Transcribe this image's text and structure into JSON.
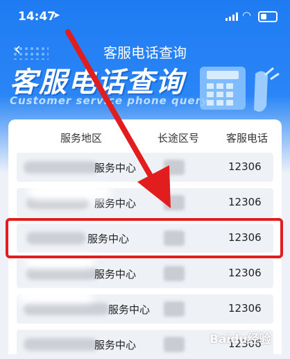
{
  "status_bar": {
    "time": "14:47",
    "location_icon": "location-arrow-icon"
  },
  "nav": {
    "title": "客服电话查询",
    "back_icon": "chevron-left-icon"
  },
  "banner": {
    "title": "客服电话查询",
    "subtitle": "Customer service phone query"
  },
  "table": {
    "headers": [
      "服务地区",
      "长途区号",
      "客服电话"
    ],
    "rows": [
      {
        "service": "服务中心",
        "phone": "12306"
      },
      {
        "service": "服务中心",
        "phone": "12306"
      },
      {
        "service": "服务中心",
        "phone": "12306"
      },
      {
        "service": "服务中心",
        "phone": "12306"
      },
      {
        "service": "服务中心",
        "phone": "12306"
      },
      {
        "service": "服务中心",
        "phone": "12306"
      }
    ]
  },
  "watermark": "Baidu经验",
  "colors": {
    "accent_blue": "#2a86f6",
    "highlight_red": "#e21d1d",
    "row_bg": "#eef1f6"
  }
}
